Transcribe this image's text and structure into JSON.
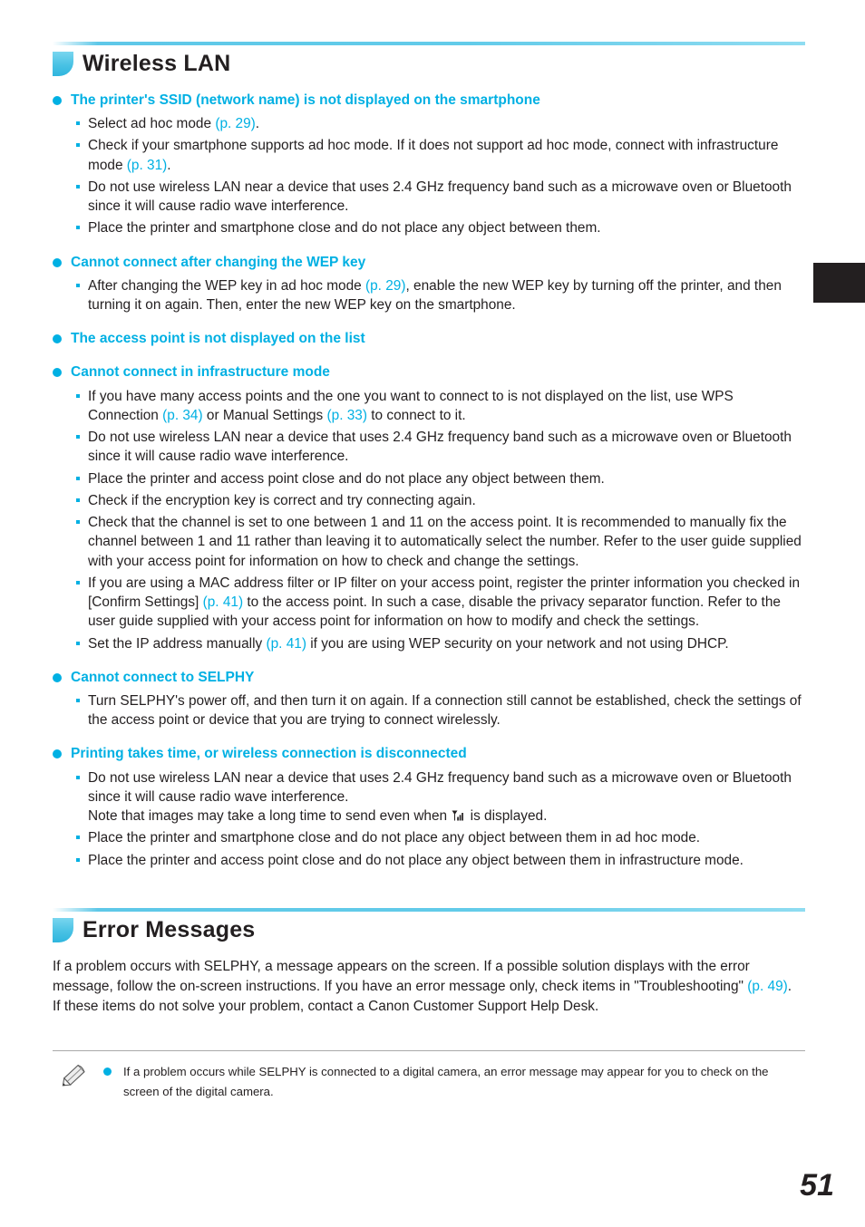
{
  "page_number": "51",
  "colors": {
    "accent": "#00b0e3",
    "text": "#231f20",
    "tab": "#231f20"
  },
  "edge_tab": {
    "name": "index-tab"
  },
  "sections": [
    {
      "id": "wireless-lan",
      "title": "Wireless LAN",
      "items": [
        {
          "heading": "The printer's SSID (network name) is not displayed on the smartphone",
          "bullets": [
            "Select ad hoc mode (p. 29).",
            "Check if your smartphone supports ad hoc mode. If it does not support ad hoc mode, connect with infrastructure mode (p. 31).",
            "Do not use wireless LAN near a device that uses 2.4 GHz frequency band such as a microwave oven or Bluetooth since it will cause radio wave interference.",
            "Place the printer and smartphone close and do not place any object between them."
          ]
        },
        {
          "heading": "Cannot connect after changing the WEP key",
          "bullets": [
            "After changing the WEP key in ad hoc mode (p. 29), enable the new WEP key by turning off the printer, and then turning it on again. Then, enter the new WEP key on the smartphone."
          ]
        },
        {
          "heading": "The access point is not displayed on the list",
          "bullets": []
        },
        {
          "heading": "Cannot connect in infrastructure mode",
          "bullets": [
            "If you have many access points and the one you want to connect to is not displayed on the list, use WPS Connection (p. 34) or Manual Settings (p. 33) to connect to it.",
            "Do not use wireless LAN near a device that uses 2.4 GHz frequency band such as a microwave oven or Bluetooth since it will cause radio wave interference.",
            "Place the printer and access point close and do not place any object between them.",
            "Check if the encryption key is correct and try connecting again.",
            "Check that the channel is set to one between 1 and 11 on the access point. It is recommended to manually fix the channel between 1 and 11 rather than leaving it to automatically select the number. Refer to the user guide supplied with your access point for information on how to check and change the settings.",
            "If you are using a MAC address filter or IP filter on your access point, register the printer information you checked in [Confirm Settings] (p. 41) to the access point.  In such a case, disable the privacy separator function. Refer to the user guide supplied with your access point for information on how to modify and check the settings.",
            "Set the IP address manually (p. 41) if you are using WEP security on your network and not using DHCP."
          ]
        },
        {
          "heading": "Cannot connect to SELPHY",
          "bullets": [
            "Turn SELPHY's power off, and then turn it on again. If a connection still cannot be established, check the settings of the access point or device that you are trying to connect wirelessly."
          ]
        },
        {
          "heading": "Printing takes time, or wireless connection is disconnected",
          "bullets": [
            "Do not use wireless LAN near a device that uses 2.4 GHz frequency band such as a microwave oven or Bluetooth since it will cause radio wave interference.\nNote that images may take a long time to send even when [SIGNAL_ICON] is displayed.",
            "Place the printer and smartphone close and do not place any object between them in ad hoc mode.",
            "Place the printer and access point close and do not place any object between them in infrastructure mode."
          ]
        }
      ]
    },
    {
      "id": "error-messages",
      "title": "Error Messages",
      "paragraphs": [
        "If a problem occurs with SELPHY, a message appears on the screen. If a possible solution displays with the error message, follow the on-screen instructions. If you have an error message only, check items in \"Troubleshooting\" (p. 49).\nIf these items do not solve your problem, contact a Canon Customer Support Help Desk."
      ]
    }
  ],
  "note": {
    "icon": "pencil-icon",
    "text": "If a problem occurs while SELPHY is connected to a digital camera, an error message may appear for you to check on the screen of the digital camera."
  }
}
